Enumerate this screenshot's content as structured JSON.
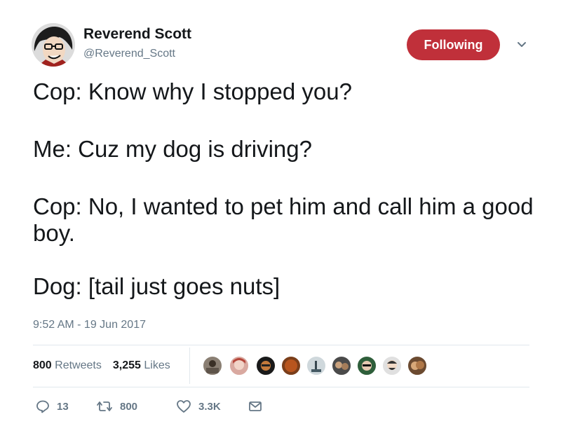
{
  "author": {
    "display_name": "Reverend Scott",
    "handle": "@Reverend_Scott",
    "avatar_icon": "cartoon-face-avatar"
  },
  "follow_button": {
    "label": "Following",
    "color": "#c0303a"
  },
  "menu_icon": "chevron-down-icon",
  "tweet": {
    "lines": [
      "Cop: Know why I stopped you?",
      "Me: Cuz my dog is driving?",
      "Cop: No, I wanted to pet him and call him a good boy.",
      "Dog: [tail just goes nuts]"
    ],
    "timestamp": "9:52 AM - 19 Jun 2017"
  },
  "stats": {
    "retweets_count": "800",
    "retweets_label": "Retweets",
    "likes_count": "3,255",
    "likes_label": "Likes"
  },
  "liked_by_avatars": [
    "liker-avatar-1",
    "liker-avatar-2",
    "liker-avatar-3",
    "liker-avatar-4",
    "liker-avatar-5",
    "liker-avatar-6",
    "liker-avatar-7",
    "liker-avatar-8",
    "liker-avatar-9"
  ],
  "actions": {
    "reply": {
      "icon": "reply-icon",
      "count": "13"
    },
    "retweet": {
      "icon": "retweet-icon",
      "count": "800"
    },
    "like": {
      "icon": "heart-icon",
      "count": "3.3K"
    },
    "message": {
      "icon": "envelope-icon"
    }
  },
  "colors": {
    "text_primary": "#14171a",
    "text_secondary": "#657786",
    "divider": "#e1e8ed",
    "follow_button": "#c0303a"
  }
}
